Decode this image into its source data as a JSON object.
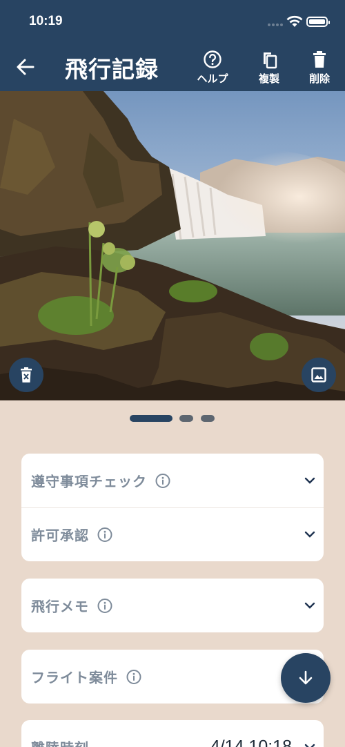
{
  "status": {
    "time": "10:19"
  },
  "nav": {
    "title": "飛行記録",
    "actions": [
      {
        "label": "ヘルプ",
        "icon": "help-circle-icon"
      },
      {
        "label": "複製",
        "icon": "copy-icon"
      },
      {
        "label": "削除",
        "icon": "trash-icon"
      }
    ]
  },
  "photo": {
    "subject": "waterfall landscape",
    "delete_icon": "delete-photo-icon",
    "gallery_icon": "image-icon"
  },
  "pager": {
    "pages": 3,
    "current": 1
  },
  "sections": {
    "compliance": {
      "label": "遵守事項チェック"
    },
    "permission": {
      "label": "許可承認"
    },
    "memo": {
      "label": "飛行メモ"
    },
    "project": {
      "label": "フライト案件"
    },
    "takeoff": {
      "label": "離陸時刻",
      "value": "4/14 10:18"
    }
  },
  "colors": {
    "primary": "#284462",
    "background": "#e9d9cc",
    "label": "#7e8b9a"
  }
}
